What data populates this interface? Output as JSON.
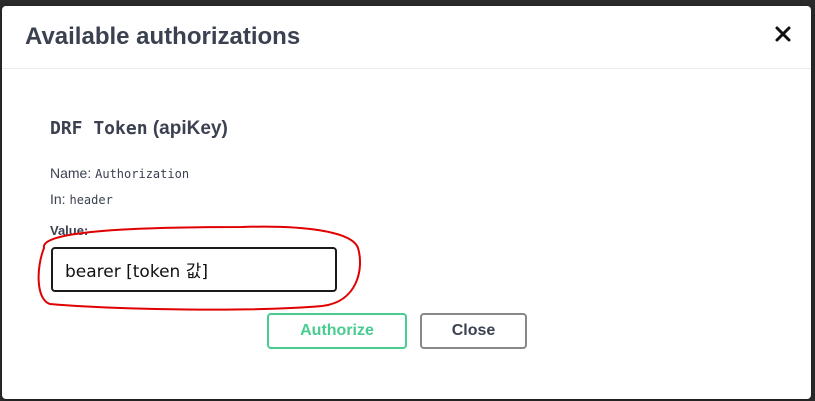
{
  "modal": {
    "title": "Available authorizations",
    "close_icon": "close-x-icon"
  },
  "auth": {
    "scheme_name": "DRF Token",
    "scheme_type": "(apiKey)",
    "name_label": "Name:",
    "name_value": "Authorization",
    "in_label": "In:",
    "in_value": "header",
    "value_label": "Value:",
    "value_input": "bearer [token 값]"
  },
  "buttons": {
    "authorize_label": "Authorize",
    "close_label": "Close"
  },
  "colors": {
    "title_text": "#3b4151",
    "authorize_green": "#49cc90",
    "annotation_red": "#e00000"
  }
}
